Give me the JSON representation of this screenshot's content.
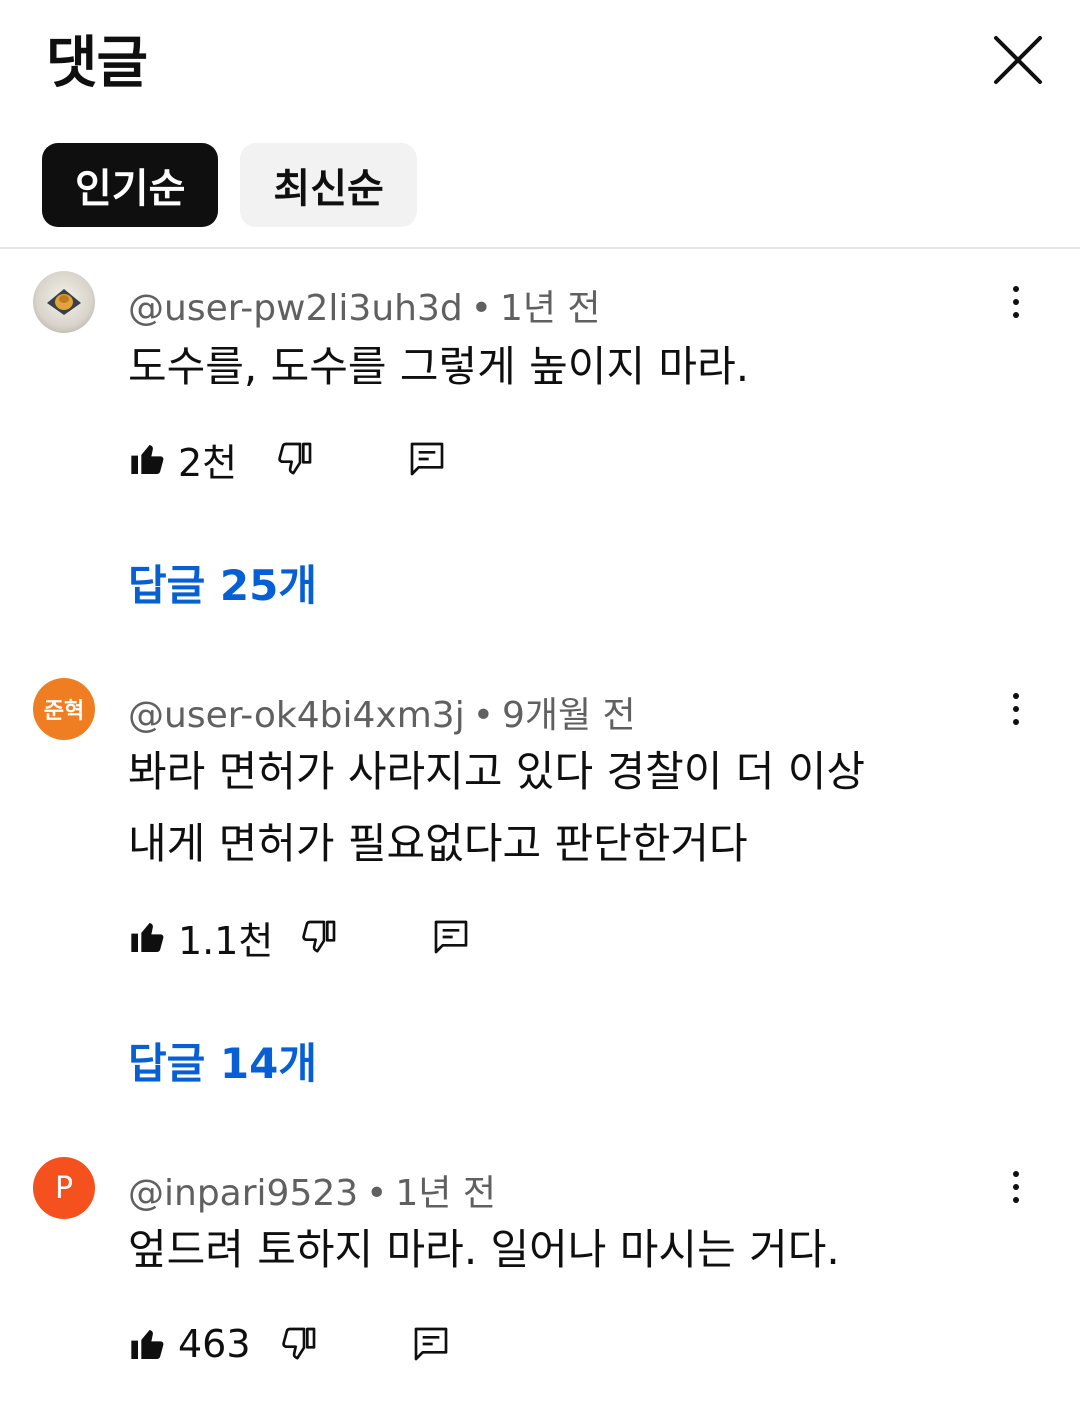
{
  "header": {
    "title": "댓글",
    "close_icon": "close-icon"
  },
  "sort_chips": [
    {
      "label": "인기순",
      "active": true
    },
    {
      "label": "최신순",
      "active": false
    }
  ],
  "colors": {
    "active_chip_bg": "#0f0f0f",
    "inactive_chip_bg": "#f2f2f2",
    "link_blue": "#065fd4",
    "meta_gray": "#606060"
  },
  "comments": [
    {
      "author": "@user-pw2li3uh3d",
      "separator": "•",
      "time": "1년 전",
      "avatar_type": "photo",
      "lines": [
        "도수를, 도수를 그렇게 높이지 마라."
      ],
      "likes": "2천",
      "replies": "답글 25개"
    },
    {
      "author": "@user-ok4bi4xm3j",
      "separator": "•",
      "time": "9개월 전",
      "avatar_type": "initials",
      "avatar_text": "준혁",
      "lines": [
        "봐라 면허가 사라지고 있다 경찰이 더 이상",
        "내게 면허가 필요없다고 판단한거다"
      ],
      "likes": "1.1천",
      "replies": "답글 14개"
    },
    {
      "author": "@inpari9523",
      "separator": "•",
      "time": "1년 전",
      "avatar_type": "letter",
      "avatar_text": "P",
      "lines": [
        "엎드려 토하지 마라. 일어나 마시는 거다."
      ],
      "likes": "463",
      "replies": null
    }
  ]
}
